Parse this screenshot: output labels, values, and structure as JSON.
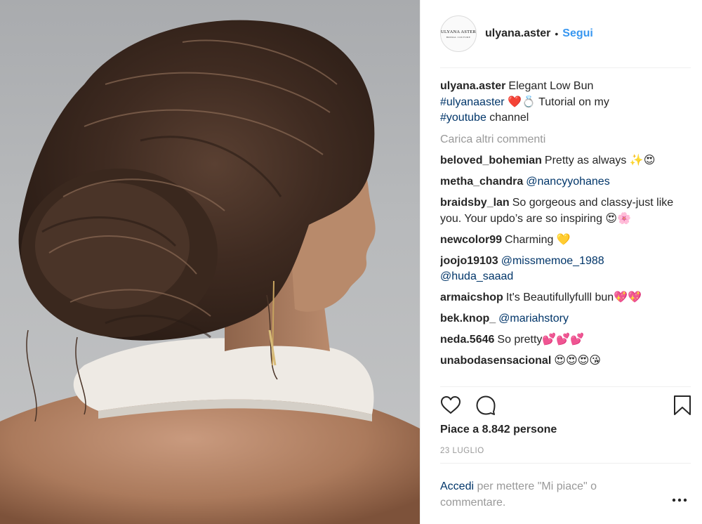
{
  "post": {
    "photo_alt": "Elegant low bun hairstyle, view from behind"
  },
  "header": {
    "avatar_brand": "ULYANA ASTER",
    "avatar_brand_sub": "BRIDAL COUTURE",
    "username": "ulyana.aster",
    "separator": "•",
    "follow_label": "Segui"
  },
  "caption": {
    "username": "ulyana.aster",
    "text_1": "Elegant Low Bun",
    "hashtag_1": "#ulyanaaster",
    "emoji": "❤️💍",
    "text_2": " Tutorial on my",
    "hashtag_2": "#youtube",
    "text_3": " channel"
  },
  "load_more": "Carica altri commenti",
  "comments": [
    {
      "user": "beloved_bohemian",
      "text": "Pretty as always ✨😍",
      "mention": "",
      "mention2": ""
    },
    {
      "user": "metha_chandra",
      "text": "",
      "mention": "@nancyyohanes",
      "mention2": ""
    },
    {
      "user": "braidsby_lan",
      "text": "So gorgeous and classy-just like you. Your updo’s are so inspiring 😍🌸",
      "mention": "",
      "mention2": ""
    },
    {
      "user": "newcolor99",
      "text": "Charming 💛",
      "mention": "",
      "mention2": ""
    },
    {
      "user": "joojo19103",
      "text": "",
      "mention": "@missmemoe_1988",
      "mention2": "@huda_saaad"
    },
    {
      "user": "armaicshop",
      "text": "It's Beautifullyfulll bun💖💖",
      "mention": "",
      "mention2": ""
    },
    {
      "user": "bek.knop_",
      "text": "",
      "mention": "@mariahstory",
      "mention2": ""
    },
    {
      "user": "neda.5646",
      "text": "So pretty💕💕💕",
      "mention": "",
      "mention2": ""
    },
    {
      "user": "unabodasensacional",
      "text": "😍😍😍😘",
      "mention": "",
      "mention2": ""
    }
  ],
  "likes": "Piace a 8.842 persone",
  "date": "23 luglio",
  "login_link": "Accedi",
  "login_text": " per mettere \"Mi piace\" o commentare.",
  "icons": {
    "like": "heart-icon",
    "comment": "speech-bubble-icon",
    "save": "bookmark-icon",
    "options": "ellipsis-icon"
  },
  "colors": {
    "follow": "#3897f0",
    "link": "#003569",
    "muted": "#999999",
    "text": "#262626"
  }
}
